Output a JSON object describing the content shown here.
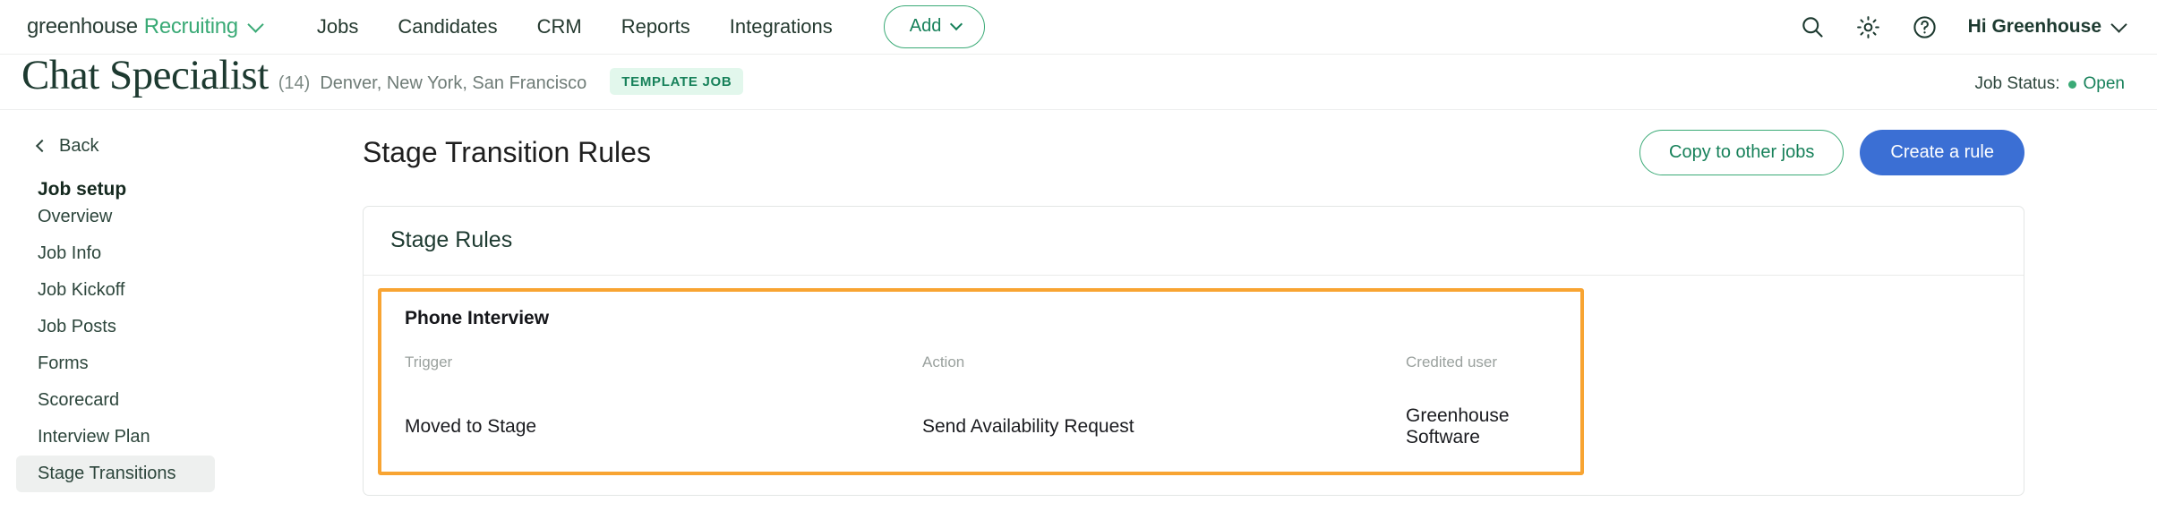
{
  "topnav": {
    "logo": {
      "primary": "greenhouse",
      "secondary": "Recruiting",
      "dropdown_icon": "chevron-down-icon"
    },
    "links": [
      "Jobs",
      "Candidates",
      "CRM",
      "Reports",
      "Integrations"
    ],
    "add_button": {
      "label": "Add",
      "icon": "chevron-down-icon"
    },
    "right": {
      "search_icon": "search-icon",
      "settings_icon": "gear-icon",
      "help_icon": "question-circle-icon",
      "greeting": "Hi Greenhouse",
      "greeting_icon": "chevron-down-icon"
    }
  },
  "title_row": {
    "job_title": "Chat Specialist",
    "job_count": "(14)",
    "locations": "Denver, New York, San Francisco",
    "badge": "TEMPLATE JOB",
    "status_label": "Job Status:",
    "status_value": "Open",
    "status_color": "#3aaa76"
  },
  "sidebar": {
    "back_label": "Back",
    "back_icon": "chevron-left-icon",
    "section_heading": "Job setup",
    "items": [
      {
        "label": "Overview",
        "active": false
      },
      {
        "label": "Job Info",
        "active": false
      },
      {
        "label": "Job Kickoff",
        "active": false
      },
      {
        "label": "Job Posts",
        "active": false
      },
      {
        "label": "Forms",
        "active": false
      },
      {
        "label": "Scorecard",
        "active": false
      },
      {
        "label": "Interview Plan",
        "active": false
      },
      {
        "label": "Stage Transitions",
        "active": true
      }
    ]
  },
  "main": {
    "page_title": "Stage Transition Rules",
    "copy_button": "Copy to other jobs",
    "create_button": "Create a rule",
    "create_button_color": "#3b6fd4",
    "card": {
      "heading": "Stage Rules",
      "highlight_color": "#f8a432",
      "rule": {
        "stage": "Phone Interview",
        "columns": [
          "Trigger",
          "Action",
          "Credited user"
        ],
        "rows": [
          [
            "Moved to Stage",
            "Send Availability Request",
            "Greenhouse Software"
          ]
        ]
      }
    }
  }
}
